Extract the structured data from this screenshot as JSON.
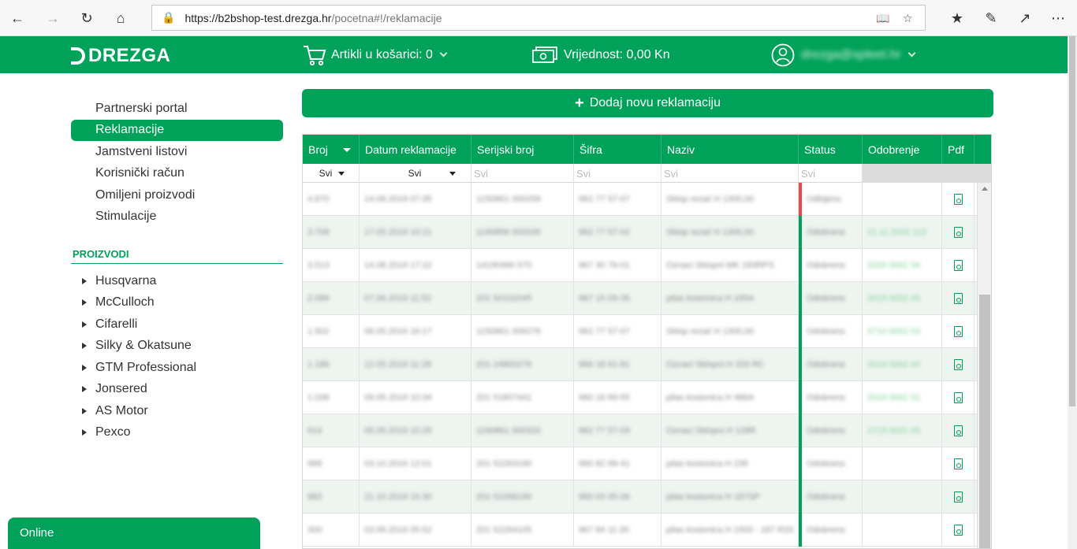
{
  "browser": {
    "url_host": "https://b2bshop-test.drezga.hr",
    "url_path": "/pocetna#!/reklamacije"
  },
  "header": {
    "logo": "DREZGA",
    "cart": "Artikli u košarici: 0",
    "value": "Vrijednost: 0,00 Kn",
    "user": "drezga@spleet.hr"
  },
  "sidebar": {
    "links": [
      {
        "label": "Partnerski portal",
        "active": false
      },
      {
        "label": "Reklamacije",
        "active": true
      },
      {
        "label": "Jamstveni listovi",
        "active": false
      },
      {
        "label": "Korisnički račun",
        "active": false
      },
      {
        "label": "Omiljeni proizvodi",
        "active": false
      },
      {
        "label": "Stimulacije",
        "active": false
      }
    ],
    "products_heading": "PROIZVODI",
    "products": [
      "Husqvarna",
      "McCulloch",
      "Cifarelli",
      "Silky & Okatsune",
      "GTM Professional",
      "Jonsered",
      "AS Motor",
      "Pexco"
    ],
    "online": "Online"
  },
  "main": {
    "add_button": "Dodaj novu reklamaciju",
    "columns": [
      "Broj",
      "Datum reklamacije",
      "Serijski broj",
      "Šifra",
      "Naziv",
      "Status",
      "Odobrenje",
      "Pdf"
    ],
    "filters": {
      "broj": "Svi",
      "datum": "Svi",
      "serijski": "Svi",
      "sifra": "Svi",
      "naziv": "Svi",
      "status": "Svi"
    },
    "rows": [
      {
        "broj": "4.870",
        "datum": "14.08.2019 07:35",
        "serijski": "1150861 000259",
        "sifra": "962 77 57-07",
        "naziv": "Sklop rezač H 1300,00",
        "status": "Odbijeno",
        "odobrenje": "",
        "status_color": "red"
      },
      {
        "broj": "3.708",
        "datum": "17.05.2019 10:21",
        "serijski": "1190856 000035",
        "sifra": "962 77 57-02",
        "naziv": "Sklop rezač H 1300,00",
        "status": "Odobreno",
        "odobrenje": "21.11.2020 113",
        "status_color": "green"
      },
      {
        "broj": "3.513",
        "datum": "14.08.2019 17:22",
        "serijski": "14190490 570",
        "sifra": "967 30 76-01",
        "naziv": "Oznaci Sklopni MK 183RPS",
        "status": "Odobreno",
        "odobrenje": "2020 0002 34",
        "status_color": "green"
      },
      {
        "broj": "2.089",
        "datum": "07.06.2019 11:52",
        "serijski": "201 50102045",
        "sifra": "967 15 09-35",
        "naziv": "pilas kosionica H 165A",
        "status": "Odobreno",
        "odobrenje": "2019 0002 26",
        "status_color": "green"
      },
      {
        "broj": "1.502",
        "datum": "06.05.2019 16:17",
        "serijski": "1150861 006276",
        "sifra": "962 77 57-07",
        "naziv": "Sklop rezač H 1300,00",
        "status": "Odobreno",
        "odobrenje": "0710 0002 03",
        "status_color": "green"
      },
      {
        "broj": "1.186",
        "datum": "12.05.2019 11:28",
        "serijski": "201 24800276",
        "sifra": "966 18 61-81",
        "naziv": "Oznaci Sklopni H 333 RC",
        "status": "Odobreno",
        "odobrenje": "2019 0002 44",
        "status_color": "green"
      },
      {
        "broj": "1.038",
        "datum": "09.05.2019 10:34",
        "serijski": "201 51807441",
        "sifra": "960 16 69-55",
        "naziv": "pilas kosionica H 486A",
        "status": "Odobreno",
        "odobrenje": "2019 0002 31",
        "status_color": "green"
      },
      {
        "broj": "914",
        "datum": "05.05.2019 10:29",
        "serijski": "1190861 000320",
        "sifra": "962 77 57-09",
        "naziv": "Oznaci Sklopni H 128R",
        "status": "Odobreno",
        "odobrenje": "1719 0001 05",
        "status_color": "green"
      },
      {
        "broj": "998",
        "datum": "03.10.2019 12:01",
        "serijski": "201 52263190",
        "sifra": "960 82 99-41",
        "naziv": "pilas kosionica H 235",
        "status": "Odobreno",
        "odobrenje": "",
        "status_color": "green"
      },
      {
        "broj": "883",
        "datum": "21.10.2019 15:30",
        "serijski": "201 52268190",
        "sifra": "960 03 35-06",
        "naziv": "pilas kosionica H 187SP",
        "status": "Odobreno",
        "odobrenje": "",
        "status_color": "green"
      },
      {
        "broj": "300",
        "datum": "03.09.2019 05:52",
        "serijski": "201 52264105",
        "sifra": "967 84 11-30",
        "naziv": "pilas kosionica H 1500 - 187 R33",
        "status": "Odobreno",
        "odobrenje": "",
        "status_color": "green"
      }
    ]
  }
}
